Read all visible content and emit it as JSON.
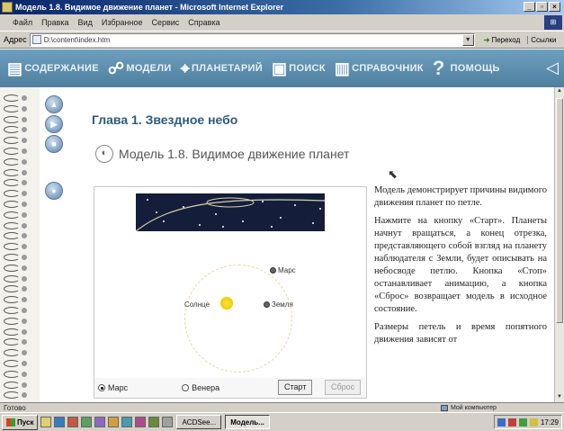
{
  "window": {
    "title": "Модель 1.8. Видимое движение планет - Microsoft Internet Explorer",
    "minimize": "_",
    "maximize": "▫",
    "close": "×"
  },
  "menu": {
    "items": [
      "Файл",
      "Правка",
      "Вид",
      "Избранное",
      "Сервис",
      "Справка"
    ]
  },
  "address": {
    "label": "Адрес",
    "value": "D:\\content\\index.htm",
    "go_label": "Переход",
    "links_label": "Ссылки"
  },
  "site_nav": {
    "items": [
      "СОДЕРЖАНИЕ",
      "МОДЕЛИ",
      "ПЛАНЕТАРИЙ",
      "ПОИСК",
      "СПРАВОЧНИК",
      "ПОМОЩЬ"
    ],
    "help_symbol": "?"
  },
  "content": {
    "chapter_title": "Глава 1. Звездное небо",
    "model_title": "Модель 1.8. Видимое движение планет"
  },
  "simulation": {
    "label_mars": "Марс",
    "label_sun": "Солнце",
    "label_earth": "Земля",
    "radio_mars": "Марс",
    "radio_venus": "Венера",
    "selected_planet": "Марс",
    "start_button": "Старт",
    "reset_button": "Сброс"
  },
  "description": {
    "paragraphs": [
      "Модель демонстрирует причины видимого движения планет по петле.",
      "Нажмите на кнопку «Старт». Планеты начнут вращаться, а конец отрезка, представляющего собой взгляд на планету наблюдателя с Земли, будет описывать на небосводе петлю. Кнопка «Стоп» останавливает анимацию, а кнопка «Сброс» возвращает модель в исходное состояние.",
      "Размеры петель и время попятного движения зависят от"
    ]
  },
  "status": {
    "text": "Готово",
    "zone": "Мой компьютер"
  },
  "taskbar": {
    "start": "Пуск",
    "tasks": [
      "ACDSee...",
      "Модель..."
    ],
    "clock": "17:29"
  }
}
